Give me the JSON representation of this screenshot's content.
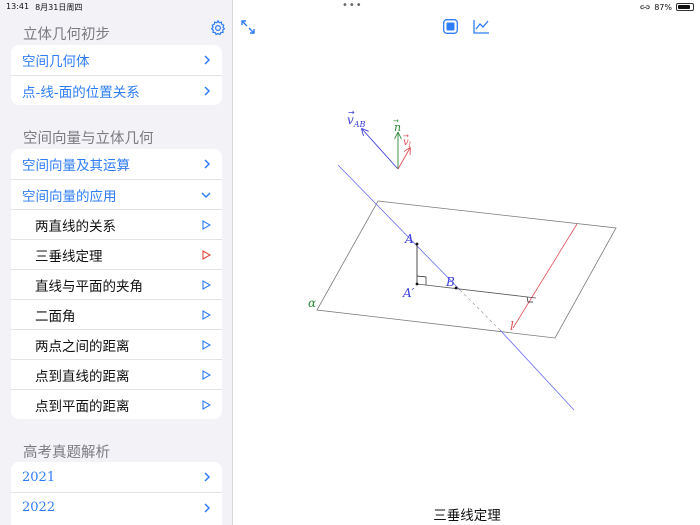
{
  "status": {
    "time": "13:41",
    "date": "8月31日周四",
    "battery": "87%",
    "battery_level": 0.87
  },
  "sidebar": {
    "sections": [
      {
        "title": "立体几何初步",
        "items": [
          {
            "label": "空间几何体"
          },
          {
            "label": "点-线-面的位置关系"
          }
        ]
      },
      {
        "title": "空间向量与立体几何",
        "items": [
          {
            "label": "空间向量及其运算"
          },
          {
            "label": "空间向量的应用",
            "expanded": true
          }
        ],
        "subitems": [
          {
            "label": "两直线的关系"
          },
          {
            "label": "三垂线定理",
            "selected": true
          },
          {
            "label": "直线与平面的夹角"
          },
          {
            "label": "二面角"
          },
          {
            "label": "两点之间的距离"
          },
          {
            "label": "点到直线的距离"
          },
          {
            "label": "点到平面的距离"
          }
        ]
      },
      {
        "title": "高考真题解析",
        "items": [
          {
            "label": "2021"
          },
          {
            "label": "2022"
          }
        ]
      }
    ]
  },
  "figure": {
    "labels": {
      "v_ab": "v",
      "v_ab_sub": "AB",
      "n": "n",
      "v_l": "v",
      "v_l_sub": "l",
      "A": "A",
      "A_prime": "A′",
      "B": "B",
      "alpha": "α",
      "l": "l"
    }
  },
  "caption": "三垂线定理",
  "colors": {
    "accent": "#2f7df6",
    "selected_play": "#e0463a",
    "vector_ab": "#3b3fd6",
    "normal": "#2e8b3a",
    "line_l": "#e0525a",
    "plane": "#7a7a7a"
  }
}
